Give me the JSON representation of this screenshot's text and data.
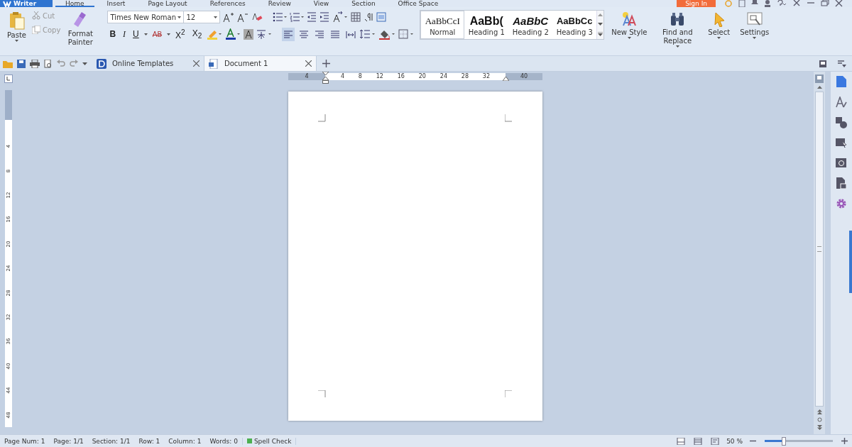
{
  "app": {
    "label": "Writer"
  },
  "menu_tabs": [
    {
      "label": "Home",
      "selected": true
    },
    {
      "label": "Insert",
      "selected": false
    },
    {
      "label": "Page Layout",
      "selected": false
    },
    {
      "label": "References",
      "selected": false
    },
    {
      "label": "Review",
      "selected": false
    },
    {
      "label": "View",
      "selected": false
    },
    {
      "label": "Section",
      "selected": false
    },
    {
      "label": "Office Space",
      "selected": false
    }
  ],
  "sign_in": "Sign In",
  "ribbon": {
    "paste": "Paste",
    "cut": "Cut",
    "copy": "Copy",
    "format_painter": "Format Painter",
    "font_name": "Times New Roman",
    "font_size": "12",
    "format_buttons": [
      {
        "kind": "bold",
        "label": "B"
      },
      {
        "kind": "italic",
        "label": "I"
      },
      {
        "kind": "underline",
        "label": "U"
      },
      {
        "kind": "strike",
        "label": "AB"
      },
      {
        "kind": "super",
        "label": "X$^{2}$"
      },
      {
        "kind": "sub",
        "label": "X$_{2}$"
      }
    ],
    "align": [
      {
        "kind": "left",
        "selected": true
      },
      {
        "kind": "center",
        "selected": false
      },
      {
        "kind": "right",
        "selected": false
      },
      {
        "kind": "justify",
        "selected": false
      },
      {
        "kind": "distribute",
        "selected": false
      }
    ],
    "styles": [
      {
        "kind": "normal",
        "preview": "AaBbCcI",
        "label": "Normal",
        "selected": true
      },
      {
        "kind": "h1",
        "preview": "AaBb(",
        "label": "Heading 1",
        "selected": false
      },
      {
        "kind": "h2",
        "preview": "AaBbC",
        "label": "Heading 2",
        "selected": false
      },
      {
        "kind": "h3",
        "preview": "AaBbCc",
        "label": "Heading 3",
        "selected": false
      }
    ],
    "new_style": "New Style",
    "find_replace": "Find and Replace",
    "select": "Select",
    "settings": "Settings"
  },
  "doc_tabs": [
    {
      "label": "Online Templates",
      "selected": false
    },
    {
      "label": "Document 1",
      "selected": true
    }
  ],
  "ruler": {
    "h_ticks": [
      "4",
      "4",
      "8",
      "12",
      "16",
      "20",
      "24",
      "28",
      "32",
      "40"
    ],
    "v_ticks": [
      "4",
      "8",
      "12",
      "16",
      "20",
      "24",
      "28",
      "32",
      "36",
      "40",
      "44",
      "48"
    ]
  },
  "status_bar": {
    "items": [
      "Page Num: 1",
      "Page: 1/1",
      "Section: 1/1",
      "Row: 1",
      "Column: 1",
      "Words: 0"
    ],
    "spell_check": "Spell Check",
    "zoom": "50 %",
    "zoom_slider": {
      "level": 0.27
    }
  }
}
